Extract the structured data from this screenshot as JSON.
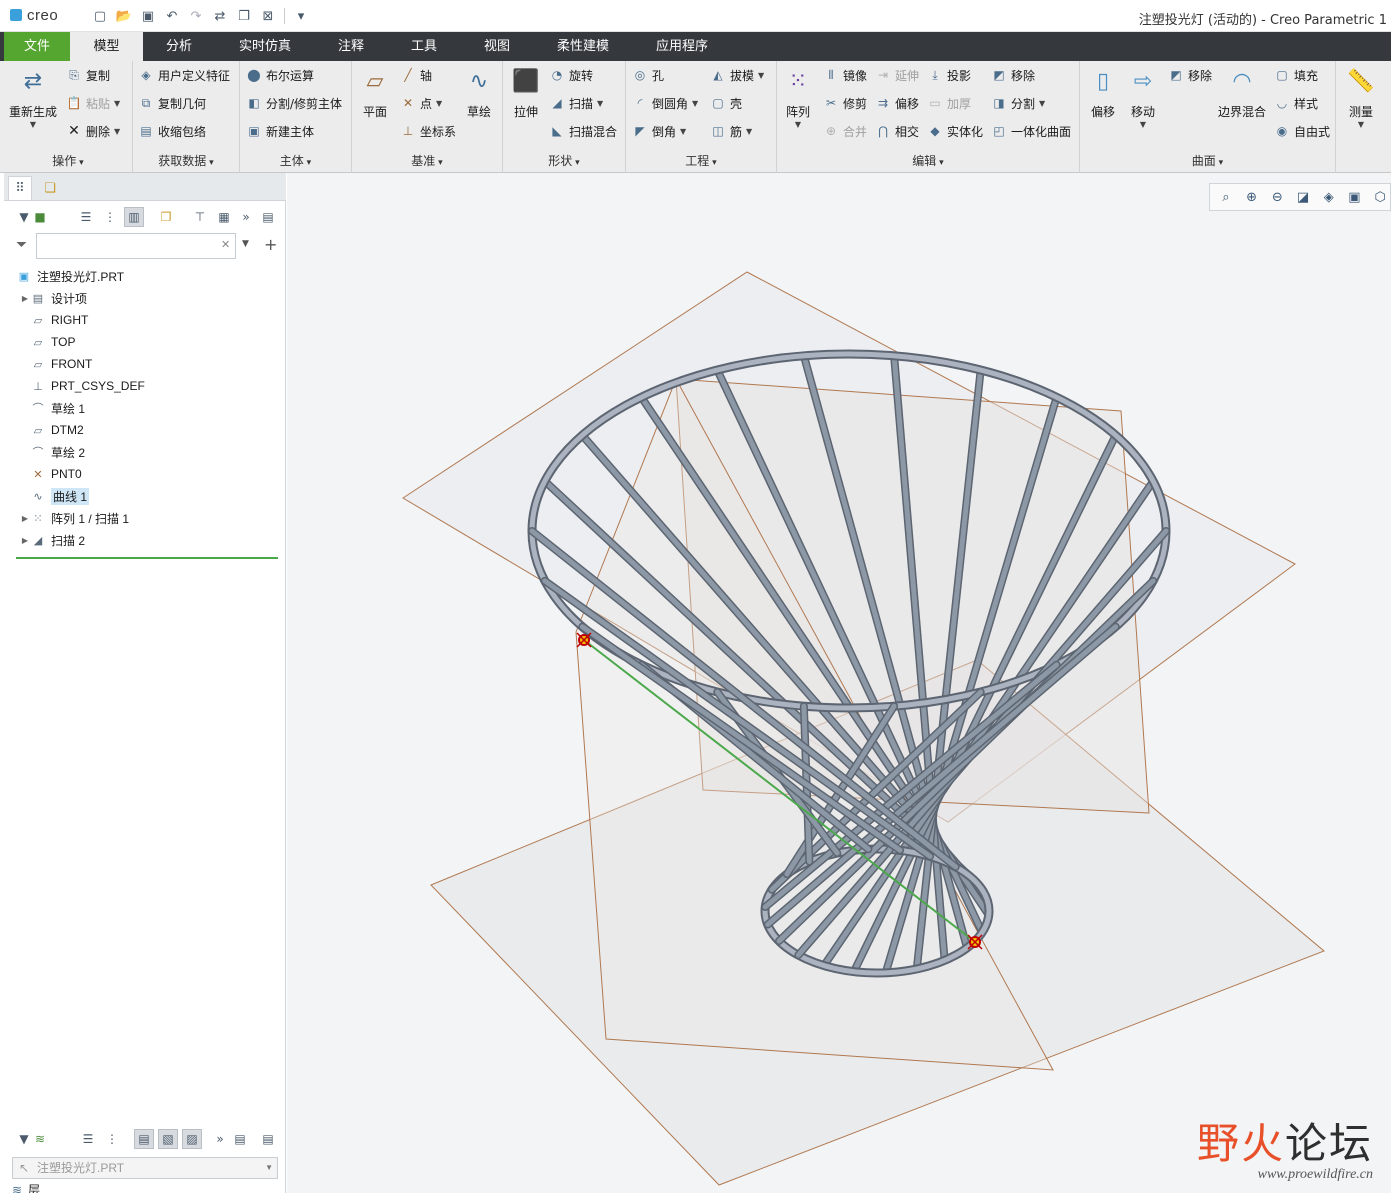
{
  "app": {
    "logo": "creo",
    "window_title": "注塑投光灯 (活动的) - Creo Parametric 1"
  },
  "quick_access": [
    "new-icon",
    "open-icon",
    "save-icon",
    "undo-icon",
    "redo-icon",
    "regenerate-icon",
    "window-icon",
    "close-icon",
    "customize-icon"
  ],
  "tabs": [
    "文件",
    "模型",
    "分析",
    "实时仿真",
    "注释",
    "工具",
    "视图",
    "柔性建模",
    "应用程序"
  ],
  "ribbon": {
    "operations": {
      "label": "操作",
      "regenerate": "重新生成",
      "copy": "复制",
      "paste": "粘贴",
      "delete": "删除"
    },
    "get_data": {
      "label": "获取数据",
      "udf": "用户定义特征",
      "copy_geom": "复制几何",
      "shrinkwrap": "收缩包络"
    },
    "body": {
      "label": "主体",
      "boolean": "布尔运算",
      "split": "分割/修剪主体",
      "new_body": "新建主体"
    },
    "datum": {
      "label": "基准",
      "plane": "平面",
      "axis": "轴",
      "point": "点",
      "csys": "坐标系",
      "sketch": "草绘"
    },
    "shapes": {
      "label": "形状",
      "extrude": "拉伸",
      "revolve": "旋转",
      "sweep": "扫描",
      "swept_blend": "扫描混合"
    },
    "engineering": {
      "label": "工程",
      "hole": "孔",
      "round": "倒圆角",
      "chamfer": "倒角",
      "draft": "拔模",
      "shell": "壳",
      "rib": "筋"
    },
    "editing": {
      "label": "编辑",
      "pattern": "阵列",
      "mirror": "镜像",
      "trim": "修剪",
      "merge": "合并",
      "extend": "延伸",
      "offset": "偏移",
      "intersect": "相交",
      "project": "投影",
      "thicken": "加厚",
      "solidify": "实体化",
      "remove": "移除",
      "split": "分割",
      "unify": "一体化曲面"
    },
    "surfaces": {
      "label": "曲面",
      "offset": "偏移",
      "move": "移动",
      "remove": "移除",
      "boundary_blend": "边界混合",
      "fill": "填充",
      "style": "样式",
      "freestyle": "自由式"
    },
    "measure": {
      "label": "测量"
    }
  },
  "model_tree": {
    "search_placeholder": "",
    "items": [
      {
        "label": "注塑投光灯.PRT",
        "icon": "part-icon",
        "expandable": false,
        "selected": false
      },
      {
        "label": "设计项",
        "icon": "design-items-icon",
        "expandable": true,
        "selected": false
      },
      {
        "label": "RIGHT",
        "icon": "datum-plane-icon",
        "expandable": false,
        "selected": false
      },
      {
        "label": "TOP",
        "icon": "datum-plane-icon",
        "expandable": false,
        "selected": false
      },
      {
        "label": "FRONT",
        "icon": "datum-plane-icon",
        "expandable": false,
        "selected": false
      },
      {
        "label": "PRT_CSYS_DEF",
        "icon": "csys-icon",
        "expandable": false,
        "selected": false
      },
      {
        "label": "草绘 1",
        "icon": "sketch-icon",
        "expandable": false,
        "selected": false
      },
      {
        "label": "DTM2",
        "icon": "datum-plane-icon",
        "expandable": false,
        "selected": false
      },
      {
        "label": "草绘 2",
        "icon": "sketch-icon",
        "expandable": false,
        "selected": false
      },
      {
        "label": "PNT0",
        "icon": "datum-point-icon",
        "expandable": false,
        "selected": false
      },
      {
        "label": "曲线 1",
        "icon": "curve-icon",
        "expandable": false,
        "selected": true
      },
      {
        "label": "阵列 1 / 扫描 1",
        "icon": "pattern-icon",
        "expandable": true,
        "selected": false
      },
      {
        "label": "扫描 2",
        "icon": "sweep-icon",
        "expandable": true,
        "selected": false
      }
    ]
  },
  "layer_panel": {
    "model_dropdown": "注塑投光灯.PRT",
    "layer_label": "层"
  },
  "watermark": {
    "title_a": "野火",
    "title_b": "论坛",
    "url": "www.proewildfire.cn"
  },
  "colors": {
    "file_tab": "#55a630",
    "tab_bar": "#35393d",
    "ribbon_bg": "#ececec",
    "viewport_bg": "#f3f4f6",
    "tube": "#8d98a6",
    "datum_plane_edge": "#b07850",
    "selection_highlight": "#cfe6f7"
  }
}
